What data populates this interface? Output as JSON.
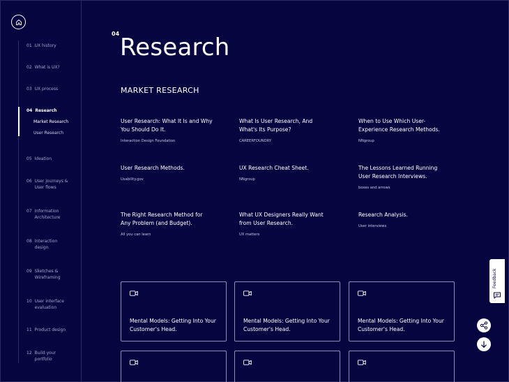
{
  "sidebar": {
    "items": [
      {
        "num": "01",
        "label": "UX history"
      },
      {
        "num": "02",
        "label": "What is UX?"
      },
      {
        "num": "03",
        "label": "UX process"
      },
      {
        "num": "04",
        "label": "Research"
      },
      {
        "num": "05",
        "label": "Ideation"
      },
      {
        "num": "06",
        "label": "User journeys & User flows"
      },
      {
        "num": "07",
        "label": "Information Architecture"
      },
      {
        "num": "08",
        "label": "Interaction design"
      },
      {
        "num": "09",
        "label": "Sketches & Wireframing"
      },
      {
        "num": "10",
        "label": "User interface evaluation"
      },
      {
        "num": "11",
        "label": "Product design"
      },
      {
        "num": "12",
        "label": "Build your portfolio"
      }
    ],
    "sub_items": [
      "Market Research",
      "User Research"
    ],
    "active_item": "Research",
    "active_sub_item": "Market Research"
  },
  "header": {
    "section_number": "04",
    "title": "Research",
    "subtitle": "MARKET RESEARCH"
  },
  "articles": [
    {
      "title": "User Research: What It Is and Why You Should Do It.",
      "source": "Interaction Design Foundation"
    },
    {
      "title": "What Is User Research, And What's Its Purpose?",
      "source": "CAREERFOUNDRY"
    },
    {
      "title": "When to Use Which User-Experience Research Methods.",
      "source": "NNgroup"
    },
    {
      "title": "User Research Methods.",
      "source": "Usability.gov"
    },
    {
      "title": "UX Research Cheat Sheet.",
      "source": "NNgroup"
    },
    {
      "title": "The Lessons Learned Running User Research Interviews.",
      "source": "boxes and arrows"
    },
    {
      "title": "The Right Research Method for Any Problem (and Budget).",
      "source": "All you can learn"
    },
    {
      "title": "What UX Designers Really Want from User Research.",
      "source": "UX matters"
    },
    {
      "title": "Research Analysis.",
      "source": "User interviews"
    }
  ],
  "videos": [
    {
      "title": "Mental Models: Getting Into Your Customer's Head.",
      "icon": "video-camera-icon"
    },
    {
      "title": "Mental Models: Getting Into Your Customer's Head.",
      "icon": "video-camera-icon"
    },
    {
      "title": "Mental Models: Getting Into Your Customer's Head.",
      "icon": "video-camera-icon"
    }
  ],
  "feedback": {
    "label": "Feedback"
  },
  "colors": {
    "background": "#070540",
    "text": "#ffffff",
    "muted": "#a6a5c8",
    "border": "#8e8db6"
  }
}
